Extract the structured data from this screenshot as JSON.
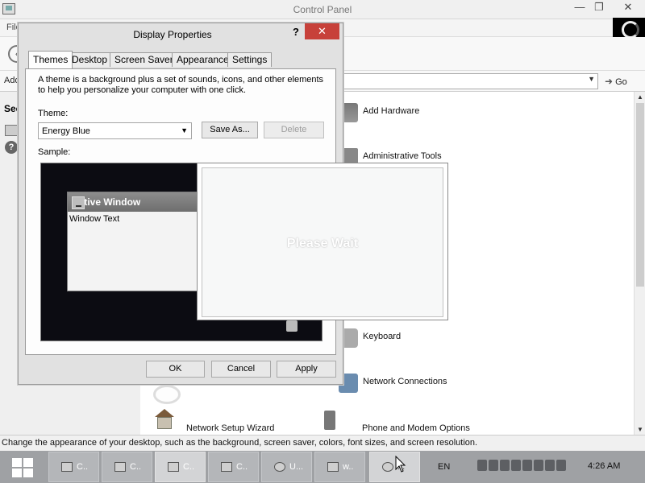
{
  "control_panel": {
    "title": "Control Panel",
    "menu_partial": "File",
    "address_label": "Address",
    "go_label": "Go",
    "sidebar_heading": "See",
    "items": [
      {
        "label": "Add Hardware",
        "icon": "hardware-icon"
      },
      {
        "label": "Administrative Tools",
        "icon": "admin-tools-icon"
      },
      {
        "label": "Keyboard",
        "icon": "keyboard-icon"
      },
      {
        "label": "Network Connections",
        "icon": "network-icon"
      },
      {
        "label": "Network Setup Wizard",
        "icon": "house-icon"
      },
      {
        "label": "Phone and Modem Options",
        "icon": "phone-icon"
      }
    ],
    "status_text": "Change the appearance of your desktop, such as the background, screen saver, colors, font sizes, and screen resolution."
  },
  "dialog": {
    "title": "Display Properties",
    "help": "?",
    "close": "✕",
    "tabs": [
      "Themes",
      "Desktop",
      "Screen Saver",
      "Appearance",
      "Settings"
    ],
    "selected_tab": "Themes",
    "description": "A theme is a background plus a set of sounds, icons, and other elements to help you personalize your computer with one click.",
    "theme_label": "Theme:",
    "theme_value": "Energy Blue",
    "save_as": "Save As...",
    "delete": "Delete",
    "sample_label": "Sample:",
    "active_window_title": "Active Window",
    "window_text": "Window Text",
    "ok": "OK",
    "cancel": "Cancel",
    "apply": "Apply"
  },
  "please_wait": {
    "text": "Please Wait"
  },
  "taskbar": {
    "buttons": [
      {
        "label": "C..",
        "icon": "folder-icon"
      },
      {
        "label": "C..",
        "icon": "folder-icon"
      },
      {
        "label": "C..",
        "icon": "control-panel-icon"
      },
      {
        "label": "C..",
        "icon": "control-panel-icon"
      },
      {
        "label": "U...",
        "icon": "disc-icon"
      },
      {
        "label": "w..",
        "icon": "stack-icon"
      },
      {
        "label": "...",
        "icon": "display-icon"
      }
    ],
    "language": "EN",
    "clock": "4:26 AM"
  },
  "colors": {
    "close_red": "#c7413a",
    "taskbar": "#9fa1a4",
    "sample_bg": "#0c0c12"
  }
}
